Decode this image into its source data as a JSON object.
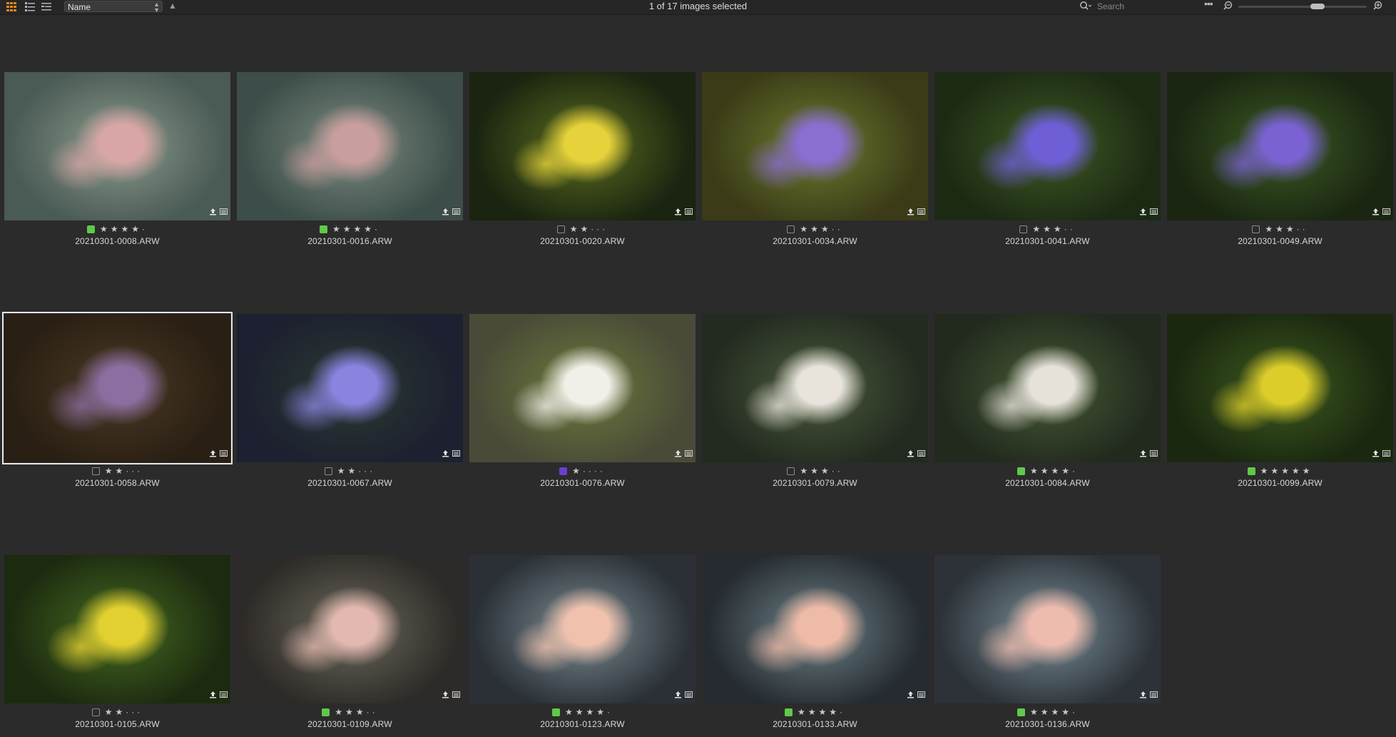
{
  "toolbar": {
    "sort_field": "Name",
    "selection_status": "1 of 17 images selected",
    "search_placeholder": "Search",
    "more_label": "•••",
    "zoom_fraction": 0.63
  },
  "grid": {
    "images": [
      {
        "filename": "20210301-0008.ARW",
        "rating": 4,
        "color_label": "#5fc94a",
        "selected": false,
        "palette": [
          "#4a5a55",
          "#d8a6a6",
          "#8a9b8c"
        ]
      },
      {
        "filename": "20210301-0016.ARW",
        "rating": 4,
        "color_label": "#5fc94a",
        "selected": false,
        "palette": [
          "#3d4d49",
          "#c99e9e",
          "#7c8c80"
        ]
      },
      {
        "filename": "20210301-0020.ARW",
        "rating": 2,
        "color_label": "",
        "selected": false,
        "palette": [
          "#1a2410",
          "#e6d23a",
          "#5b6e20"
        ]
      },
      {
        "filename": "20210301-0034.ARW",
        "rating": 3,
        "color_label": "",
        "selected": false,
        "palette": [
          "#3b3b18",
          "#8a6ed0",
          "#6b7a2c"
        ]
      },
      {
        "filename": "20210301-0041.ARW",
        "rating": 3,
        "color_label": "",
        "selected": false,
        "palette": [
          "#1c2a14",
          "#6e5fd6",
          "#3f5a24"
        ]
      },
      {
        "filename": "20210301-0049.ARW",
        "rating": 3,
        "color_label": "",
        "selected": false,
        "palette": [
          "#1a2612",
          "#7a62d2",
          "#3c5a22"
        ]
      },
      {
        "filename": "20210301-0058.ARW",
        "rating": 2,
        "color_label": "",
        "selected": true,
        "palette": [
          "#2a1f14",
          "#8c6ea0",
          "#4a3a24"
        ]
      },
      {
        "filename": "20210301-0067.ARW",
        "rating": 2,
        "color_label": "",
        "selected": false,
        "palette": [
          "#1d2030",
          "#8a84e0",
          "#2a3a30"
        ]
      },
      {
        "filename": "20210301-0076.ARW",
        "rating": 1,
        "color_label": "#6a3fd0",
        "selected": false,
        "palette": [
          "#4a4a38",
          "#f2efe8",
          "#6a7a3a"
        ]
      },
      {
        "filename": "20210301-0079.ARW",
        "rating": 3,
        "color_label": "",
        "selected": false,
        "palette": [
          "#232a20",
          "#e8e4dc",
          "#4a5a3a"
        ]
      },
      {
        "filename": "20210301-0084.ARW",
        "rating": 4,
        "color_label": "#5fc94a",
        "selected": false,
        "palette": [
          "#222a1e",
          "#e6e2da",
          "#475a34"
        ]
      },
      {
        "filename": "20210301-0099.ARW",
        "rating": 5,
        "color_label": "#5fc94a",
        "selected": false,
        "palette": [
          "#1a2810",
          "#dccd2a",
          "#3e5a1e"
        ]
      },
      {
        "filename": "20210301-0105.ARW",
        "rating": 2,
        "color_label": "",
        "selected": false,
        "palette": [
          "#1c2a10",
          "#e2d030",
          "#466a20"
        ]
      },
      {
        "filename": "20210301-0109.ARW",
        "rating": 3,
        "color_label": "#5fc94a",
        "selected": false,
        "palette": [
          "#2e2a28",
          "#e2b8b0",
          "#6a6a5a"
        ]
      },
      {
        "filename": "20210301-0123.ARW",
        "rating": 4,
        "color_label": "#5fc94a",
        "selected": false,
        "palette": [
          "#2a3036",
          "#f0c2ae",
          "#7a8c92"
        ]
      },
      {
        "filename": "20210301-0133.ARW",
        "rating": 4,
        "color_label": "#5fc94a",
        "selected": false,
        "palette": [
          "#252b30",
          "#eebba8",
          "#6e8288"
        ]
      },
      {
        "filename": "20210301-0136.ARW",
        "rating": 4,
        "color_label": "#5fc94a",
        "selected": false,
        "palette": [
          "#2c3238",
          "#eebcae",
          "#7a8e96"
        ]
      }
    ]
  }
}
